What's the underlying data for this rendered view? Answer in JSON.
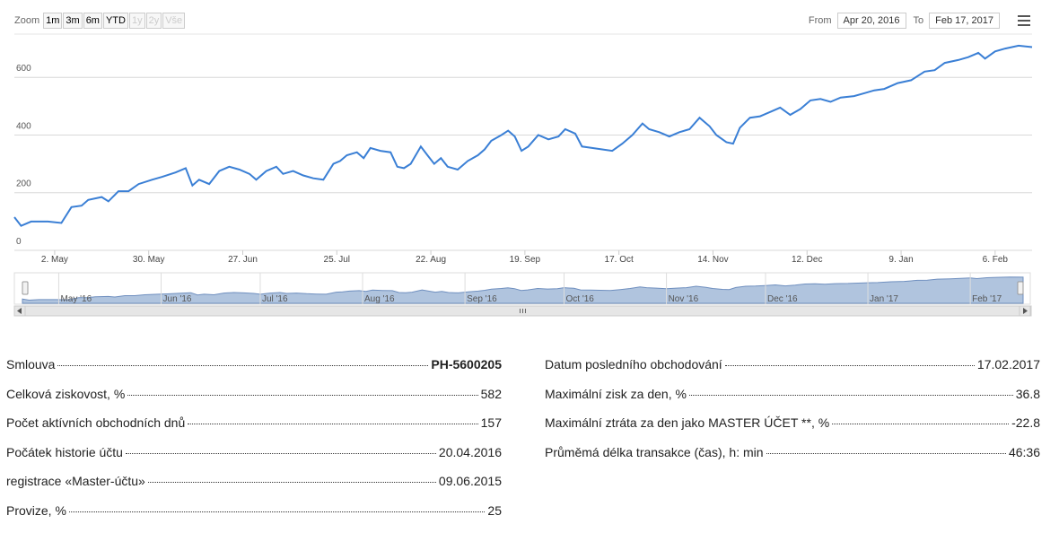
{
  "range_selector": {
    "zoom_label": "Zoom",
    "buttons": [
      {
        "label": "1m",
        "enabled": true
      },
      {
        "label": "3m",
        "enabled": true
      },
      {
        "label": "6m",
        "enabled": true
      },
      {
        "label": "YTD",
        "enabled": true
      },
      {
        "label": "1y",
        "enabled": false
      },
      {
        "label": "2y",
        "enabled": false
      },
      {
        "label": "Vše",
        "enabled": false
      }
    ]
  },
  "date_range": {
    "from_label": "From",
    "from_value": "Apr 20, 2016",
    "to_label": "To",
    "to_value": "Feb 17, 2017"
  },
  "menu_icon": "hamburger-icon",
  "chart_data": {
    "type": "line",
    "color": "#3a7fd5",
    "ylim": [
      0,
      750
    ],
    "y_ticks": [
      0,
      200,
      400,
      600
    ],
    "x_range": [
      "2016-04-20",
      "2017-02-17"
    ],
    "x_ticks": [
      {
        "label": "2. May",
        "date": "2016-05-02"
      },
      {
        "label": "30. May",
        "date": "2016-05-30"
      },
      {
        "label": "27. Jun",
        "date": "2016-06-27"
      },
      {
        "label": "25. Jul",
        "date": "2016-07-25"
      },
      {
        "label": "22. Aug",
        "date": "2016-08-22"
      },
      {
        "label": "19. Sep",
        "date": "2016-09-19"
      },
      {
        "label": "17. Oct",
        "date": "2016-10-17"
      },
      {
        "label": "14. Nov",
        "date": "2016-11-14"
      },
      {
        "label": "12. Dec",
        "date": "2016-12-12"
      },
      {
        "label": "9. Jan",
        "date": "2017-01-09"
      },
      {
        "label": "6. Feb",
        "date": "2017-02-06"
      }
    ],
    "grid": true,
    "series": [
      {
        "points": [
          [
            "2016-04-20",
            115
          ],
          [
            "2016-04-22",
            85
          ],
          [
            "2016-04-25",
            100
          ],
          [
            "2016-04-30",
            100
          ],
          [
            "2016-05-04",
            95
          ],
          [
            "2016-05-07",
            150
          ],
          [
            "2016-05-10",
            155
          ],
          [
            "2016-05-12",
            175
          ],
          [
            "2016-05-16",
            185
          ],
          [
            "2016-05-18",
            170
          ],
          [
            "2016-05-21",
            205
          ],
          [
            "2016-05-24",
            205
          ],
          [
            "2016-05-27",
            230
          ],
          [
            "2016-05-31",
            245
          ],
          [
            "2016-06-03",
            255
          ],
          [
            "2016-06-07",
            270
          ],
          [
            "2016-06-10",
            285
          ],
          [
            "2016-06-12",
            225
          ],
          [
            "2016-06-14",
            245
          ],
          [
            "2016-06-17",
            230
          ],
          [
            "2016-06-20",
            275
          ],
          [
            "2016-06-23",
            290
          ],
          [
            "2016-06-26",
            280
          ],
          [
            "2016-06-29",
            265
          ],
          [
            "2016-07-01",
            245
          ],
          [
            "2016-07-04",
            275
          ],
          [
            "2016-07-07",
            290
          ],
          [
            "2016-07-09",
            265
          ],
          [
            "2016-07-12",
            275
          ],
          [
            "2016-07-15",
            260
          ],
          [
            "2016-07-18",
            250
          ],
          [
            "2016-07-21",
            245
          ],
          [
            "2016-07-24",
            300
          ],
          [
            "2016-07-26",
            310
          ],
          [
            "2016-07-28",
            330
          ],
          [
            "2016-07-31",
            340
          ],
          [
            "2016-08-02",
            320
          ],
          [
            "2016-08-04",
            355
          ],
          [
            "2016-08-07",
            345
          ],
          [
            "2016-08-10",
            340
          ],
          [
            "2016-08-12",
            290
          ],
          [
            "2016-08-14",
            285
          ],
          [
            "2016-08-16",
            300
          ],
          [
            "2016-08-19",
            360
          ],
          [
            "2016-08-21",
            330
          ],
          [
            "2016-08-23",
            300
          ],
          [
            "2016-08-25",
            320
          ],
          [
            "2016-08-27",
            290
          ],
          [
            "2016-08-30",
            280
          ],
          [
            "2016-09-02",
            310
          ],
          [
            "2016-09-05",
            330
          ],
          [
            "2016-09-07",
            350
          ],
          [
            "2016-09-09",
            380
          ],
          [
            "2016-09-12",
            400
          ],
          [
            "2016-09-14",
            415
          ],
          [
            "2016-09-16",
            395
          ],
          [
            "2016-09-18",
            345
          ],
          [
            "2016-09-20",
            360
          ],
          [
            "2016-09-23",
            400
          ],
          [
            "2016-09-26",
            385
          ],
          [
            "2016-09-29",
            395
          ],
          [
            "2016-10-01",
            420
          ],
          [
            "2016-10-04",
            405
          ],
          [
            "2016-10-06",
            360
          ],
          [
            "2016-10-09",
            355
          ],
          [
            "2016-10-12",
            350
          ],
          [
            "2016-10-15",
            345
          ],
          [
            "2016-10-18",
            370
          ],
          [
            "2016-10-21",
            400
          ],
          [
            "2016-10-24",
            440
          ],
          [
            "2016-10-26",
            420
          ],
          [
            "2016-10-29",
            410
          ],
          [
            "2016-11-01",
            395
          ],
          [
            "2016-11-04",
            410
          ],
          [
            "2016-11-07",
            420
          ],
          [
            "2016-11-10",
            460
          ],
          [
            "2016-11-13",
            430
          ],
          [
            "2016-11-15",
            400
          ],
          [
            "2016-11-18",
            375
          ],
          [
            "2016-11-20",
            370
          ],
          [
            "2016-11-22",
            425
          ],
          [
            "2016-11-25",
            460
          ],
          [
            "2016-11-28",
            465
          ],
          [
            "2016-12-01",
            480
          ],
          [
            "2016-12-04",
            495
          ],
          [
            "2016-12-07",
            470
          ],
          [
            "2016-12-10",
            490
          ],
          [
            "2016-12-13",
            520
          ],
          [
            "2016-12-16",
            525
          ],
          [
            "2016-12-19",
            515
          ],
          [
            "2016-12-22",
            530
          ],
          [
            "2016-12-26",
            535
          ],
          [
            "2016-12-29",
            545
          ],
          [
            "2017-01-01",
            555
          ],
          [
            "2017-01-04",
            560
          ],
          [
            "2017-01-08",
            580
          ],
          [
            "2017-01-12",
            590
          ],
          [
            "2017-01-16",
            620
          ],
          [
            "2017-01-19",
            625
          ],
          [
            "2017-01-22",
            650
          ],
          [
            "2017-01-26",
            660
          ],
          [
            "2017-01-29",
            670
          ],
          [
            "2017-02-01",
            685
          ],
          [
            "2017-02-03",
            665
          ],
          [
            "2017-02-06",
            690
          ],
          [
            "2017-02-09",
            700
          ],
          [
            "2017-02-13",
            710
          ],
          [
            "2017-02-17",
            705
          ]
        ]
      }
    ]
  },
  "navigator": {
    "month_labels": [
      "May '16",
      "Jun '16",
      "Jul '16",
      "Aug '16",
      "Sep '16",
      "Oct '16",
      "Nov '16",
      "Dec '16",
      "Jan '17",
      "Feb '17"
    ],
    "month_dates": [
      "2016-05-01",
      "2016-06-01",
      "2016-07-01",
      "2016-08-01",
      "2016-09-01",
      "2016-10-01",
      "2016-11-01",
      "2016-12-01",
      "2017-01-01",
      "2017-02-01"
    ],
    "scroll_left_icon": "arrow-left-icon",
    "scroll_right_icon": "arrow-right-icon",
    "grip_icon": "grip-icon"
  },
  "stats": {
    "left": [
      {
        "label": "Smlouva",
        "value": "PH-5600205",
        "bold": true
      },
      {
        "label": "Celková ziskovost, %",
        "value": "582"
      },
      {
        "label": "Počet aktívních obchodních dnů",
        "value": "157"
      },
      {
        "label": "Počátek historie účtu",
        "value": "20.04.2016"
      },
      {
        "label": "registrace «Master-účtu»",
        "value": "09.06.2015"
      },
      {
        "label": "Provize, %",
        "value": "25"
      }
    ],
    "right": [
      {
        "label": "Datum posledního obchodování",
        "value": "17.02.2017"
      },
      {
        "label": "Maximální zisk za den, %",
        "value": "36.8"
      },
      {
        "label": "Maximální ztráta za den jako MASTER ÚČET **, %",
        "value": "-22.8"
      },
      {
        "label": "Průměmá délka transakce (čas), h: min",
        "value": "46:36"
      }
    ]
  }
}
